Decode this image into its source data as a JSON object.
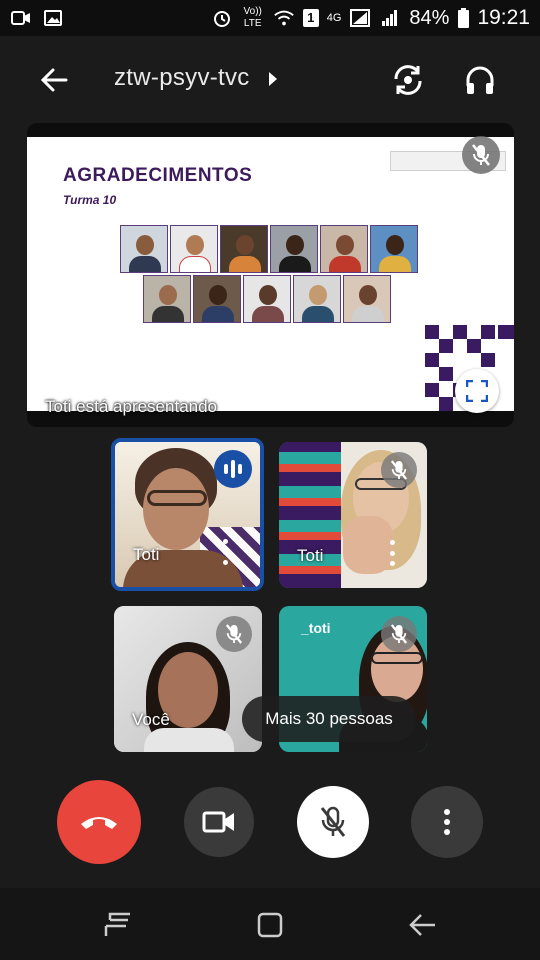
{
  "status_bar": {
    "volte_label": "Vo)) LTE",
    "sim_label": "1",
    "network_label": "4G",
    "battery_percent": "84%",
    "time": "19:21"
  },
  "header": {
    "meeting_code": "ztw-psyv-tvc"
  },
  "presentation": {
    "slide_title": "AGRADECIMENTOS",
    "slide_subtitle": "Turma 10",
    "presenting_label": "Toti está apresentando"
  },
  "tiles": [
    {
      "name": "Toti",
      "speaking": true
    },
    {
      "name": "Toti",
      "muted": true
    },
    {
      "name": "Você",
      "muted": true
    },
    {
      "name": "",
      "muted": true
    }
  ],
  "more_people_label": "Mais 30 pessoas",
  "colors": {
    "end_call": "#e8453c",
    "speaking_blue": "#1a4fa6",
    "slide_purple": "#3c1a5b",
    "teal": "#2aa8a0"
  }
}
